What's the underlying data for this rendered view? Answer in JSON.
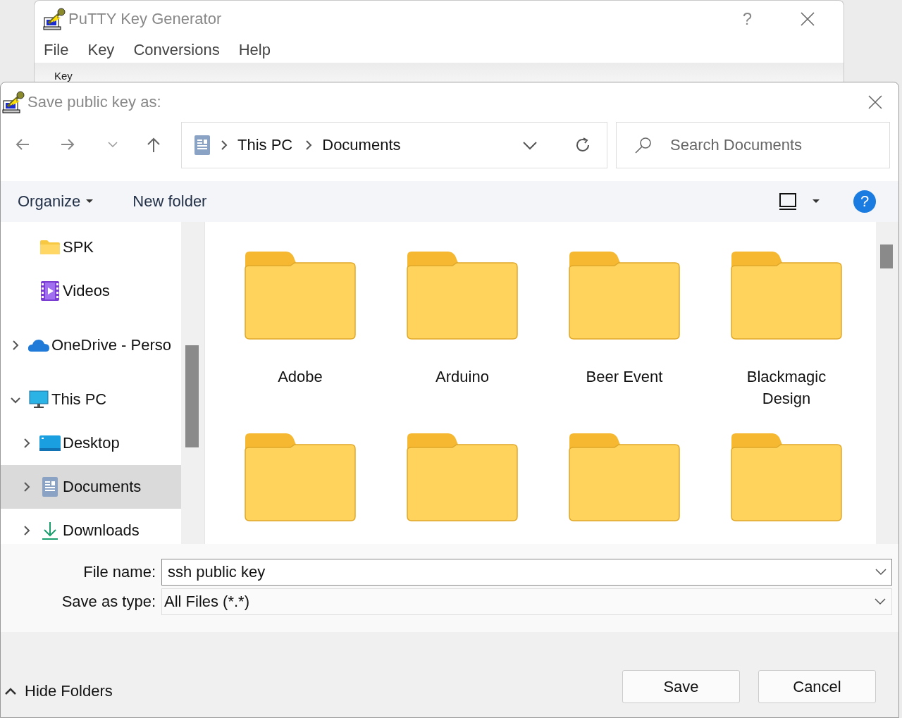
{
  "background_window": {
    "title": "PuTTY Key Generator",
    "help": "?",
    "menu": [
      "File",
      "Key",
      "Conversions",
      "Help"
    ],
    "group_label": "Key"
  },
  "dialog": {
    "title": "Save public key as:"
  },
  "address_bar": {
    "path": [
      "This PC",
      "Documents"
    ]
  },
  "search": {
    "placeholder": "Search Documents"
  },
  "toolbar": {
    "organize": "Organize",
    "new_folder": "New folder",
    "help": "?"
  },
  "sidebar": {
    "continued_items": [
      {
        "label": "SPK",
        "kind": "folder",
        "selected": false
      },
      {
        "label": "Videos",
        "kind": "video",
        "selected": false
      }
    ],
    "items": [
      {
        "label": "OneDrive - Perso",
        "kind": "cloud",
        "expanded": false,
        "selected": false
      },
      {
        "label": "This PC",
        "kind": "computer",
        "expanded": true,
        "selected": false,
        "children": [
          {
            "label": "Desktop",
            "kind": "desktop",
            "expanded": false,
            "selected": false
          },
          {
            "label": "Documents",
            "kind": "documents",
            "expanded": false,
            "selected": true
          },
          {
            "label": "Downloads",
            "kind": "downloads",
            "expanded": false,
            "selected": false
          }
        ]
      }
    ]
  },
  "folders": [
    {
      "kind": "folder",
      "label": "Adobe"
    },
    {
      "kind": "folder",
      "label": "Arduino"
    },
    {
      "kind": "folder",
      "label": "Beer Event"
    },
    {
      "kind": "folder",
      "label": "Blackmagic Design"
    },
    {
      "kind": "folder"
    },
    {
      "kind": "folder"
    },
    {
      "kind": "folder"
    },
    {
      "kind": "folder"
    }
  ],
  "file_name": {
    "label": "File name:",
    "value": "ssh public key"
  },
  "save_as_type": {
    "label": "Save as type:",
    "value": "All Files (*.*)"
  },
  "hide_folders": "Hide Folders",
  "buttons": [
    "Save",
    "Cancel"
  ]
}
